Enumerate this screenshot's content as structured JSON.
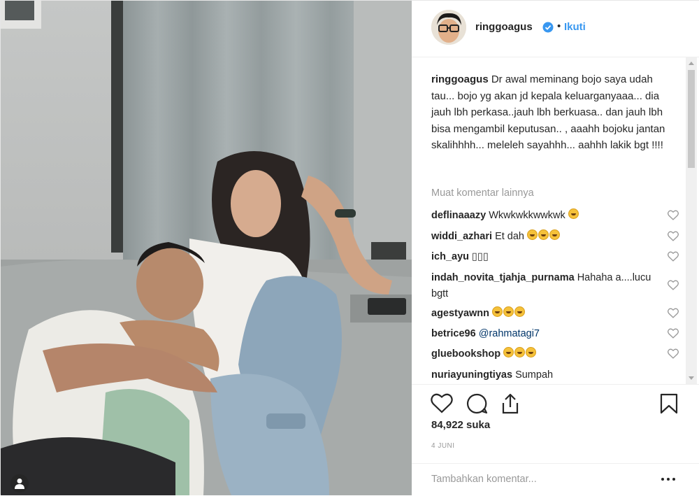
{
  "header": {
    "username": "ringgoagus",
    "dot": "•",
    "follow_label": "Ikuti"
  },
  "caption": {
    "username": "ringgoagus",
    "text": "Dr awal meminang bojo saya udah tau... bojo yg akan jd kepala keluarganyaaa... dia jauh lbh perkasa..jauh lbh berkuasa.. dan jauh lbh bisa mengambil keputusan.. , aaahh bojoku jantan skalihhhh... meleleh sayahhh... aahhh lakik bgt !!!!"
  },
  "load_more_label": "Muat komentar lainnya",
  "comments": [
    {
      "user": "deflinaaazy",
      "text": "Wkwkwkkwwkwk",
      "emojis": 1
    },
    {
      "user": "widdi_azhari",
      "text": "Et dah",
      "emojis": 3
    },
    {
      "user": "ich_ayu",
      "text": "▯▯▯",
      "emojis": 0
    },
    {
      "user": "indah_novita_tjahja_purnama",
      "text": "Hahaha a....lucu bgtt",
      "emojis": 0
    },
    {
      "user": "agestyawnn",
      "text": "",
      "emojis": 3
    },
    {
      "user": "betrice96",
      "text": "@rahmatagi7",
      "emojis": 0
    },
    {
      "user": "gluebookshop",
      "text": "",
      "emojis": 3
    },
    {
      "user": "nuriayuningtiyas",
      "text": "Sumpah",
      "emojis": 0
    }
  ],
  "actions": {
    "like_icon": "heart-icon",
    "comment_icon": "comment-icon",
    "share_icon": "share-icon",
    "save_icon": "bookmark-icon"
  },
  "likes_label": "84,922 suka",
  "date_label": "4 JUNI",
  "add_comment_placeholder": "Tambahkan komentar...",
  "colors": {
    "text": "#262626",
    "muted": "#999999",
    "link": "#3897f0",
    "border": "#efefef"
  }
}
